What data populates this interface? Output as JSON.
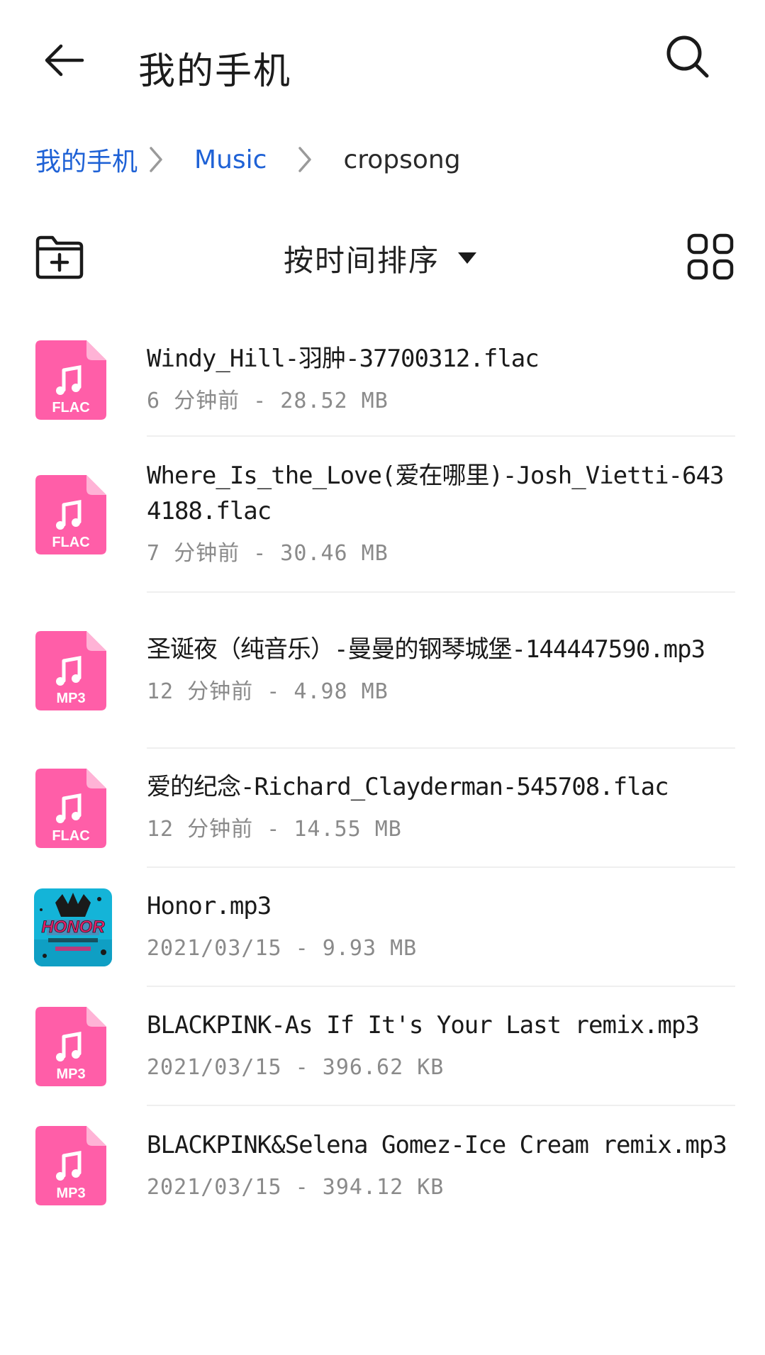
{
  "header": {
    "title": "我的手机"
  },
  "breadcrumb": {
    "items": [
      "我的手机",
      "Music",
      "cropsong"
    ]
  },
  "toolbar": {
    "sort_label": "按时间排序"
  },
  "files": [
    {
      "name": "Windy_Hill-羽肿-37700312.flac",
      "meta": "6 分钟前 - 28.52 MB",
      "type": "FLAC"
    },
    {
      "name": "Where_Is_the_Love(爱在哪里)-Josh_Vietti-6434188.flac",
      "meta": "7 分钟前 - 30.46 MB",
      "type": "FLAC"
    },
    {
      "name": "圣诞夜（纯音乐）-曼曼的钢琴城堡-144447590.mp3",
      "meta": "12 分钟前 - 4.98 MB",
      "type": "MP3"
    },
    {
      "name": "爱的纪念-Richard_Clayderman-545708.flac",
      "meta": "12 分钟前 - 14.55 MB",
      "type": "FLAC"
    },
    {
      "name": "Honor.mp3",
      "meta": "2021/03/15 - 9.93 MB",
      "type": "album",
      "art_text": "HONOR"
    },
    {
      "name": "BLACKPINK-As If It's Your Last remix.mp3",
      "meta": "2021/03/15 - 396.62 KB",
      "type": "MP3"
    },
    {
      "name": "BLACKPINK&Selena Gomez-Ice Cream remix.mp3",
      "meta": "2021/03/15 - 394.12 KB",
      "type": "MP3"
    }
  ],
  "colors": {
    "accent": "#1f62d6",
    "file_icon_pink": "#ff5ea8",
    "file_icon_fold": "#ffb3d6",
    "album_bg": "#14b4d8",
    "album_text": "#e2206a"
  }
}
